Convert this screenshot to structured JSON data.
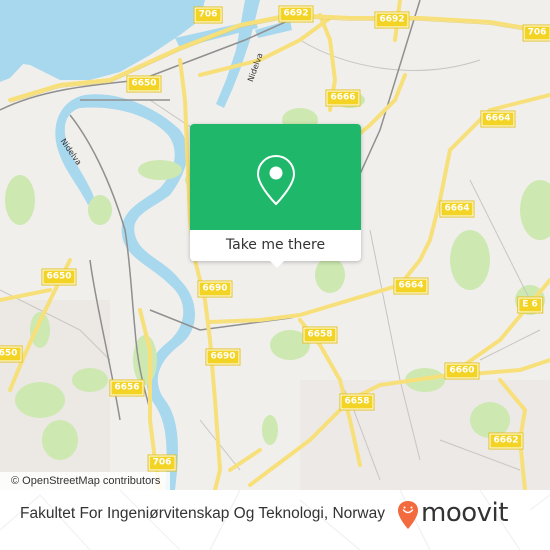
{
  "map": {
    "attribution": "© OpenStreetMap contributors",
    "colors": {
      "water": "#a7d8ee",
      "land": "#f1efec",
      "park": "#cde8b0",
      "road": "#f7e07a",
      "shield": "#f3d424",
      "popup_green": "#1fb86b"
    },
    "road_shields": [
      {
        "label": "706",
        "id": "706-north"
      },
      {
        "label": "6692",
        "id": "6692-west"
      },
      {
        "label": "6692",
        "id": "6692-east"
      },
      {
        "label": "706",
        "id": "706-east"
      },
      {
        "label": "6650",
        "id": "6650-north"
      },
      {
        "label": "6666",
        "id": "6666"
      },
      {
        "label": "6664",
        "id": "6664-north"
      },
      {
        "label": "6664",
        "id": "6664-mid"
      },
      {
        "label": "6664",
        "id": "6664-south"
      },
      {
        "label": "E 6",
        "id": "e6"
      },
      {
        "label": "6650",
        "id": "6650-west"
      },
      {
        "label": "650",
        "id": "6650-edge"
      },
      {
        "label": "6690",
        "id": "6690-north"
      },
      {
        "label": "6690",
        "id": "6690-south"
      },
      {
        "label": "6658",
        "id": "6658-north"
      },
      {
        "label": "6658",
        "id": "6658-south"
      },
      {
        "label": "6660",
        "id": "6660"
      },
      {
        "label": "6656",
        "id": "6656"
      },
      {
        "label": "706",
        "id": "706-south"
      },
      {
        "label": "6662",
        "id": "6662"
      }
    ],
    "river_labels": [
      "Nidelva",
      "Nidelva"
    ]
  },
  "popup": {
    "icon": "map-pin-icon",
    "button_label": "Take me there"
  },
  "footer": {
    "location_title": "Fakultet For Ingeniørvitenskap Og Teknologi, Norway",
    "brand": "moovit",
    "brand_color": "#f26a3d"
  }
}
